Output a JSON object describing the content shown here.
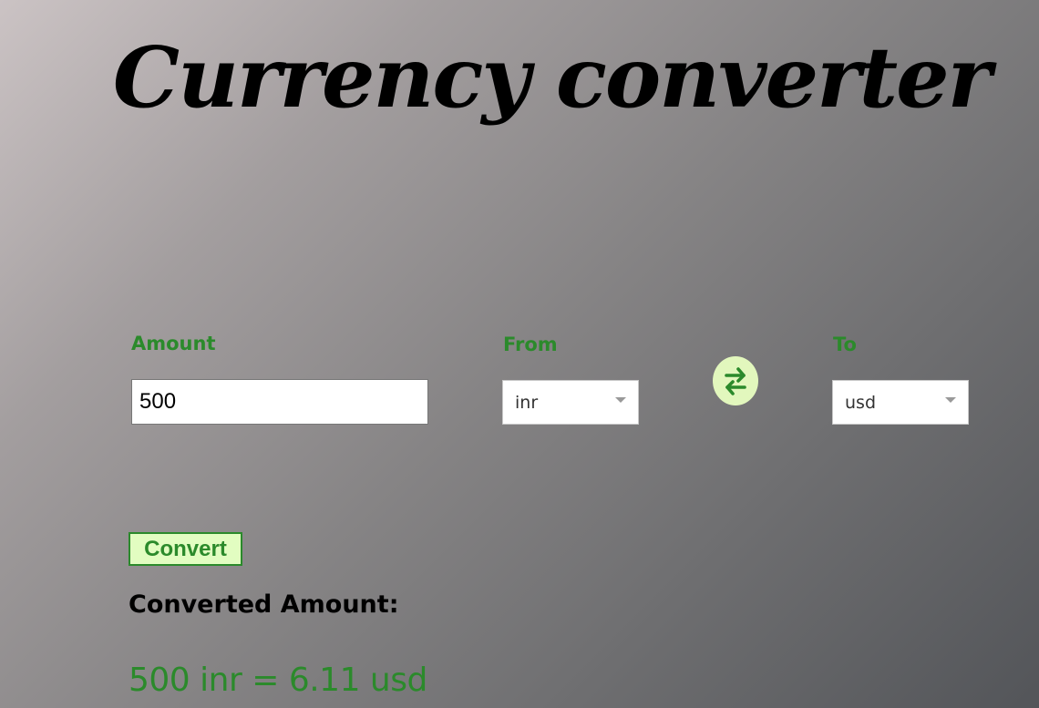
{
  "title": "Currency converter",
  "amount": {
    "label": "Amount",
    "value": "500"
  },
  "from": {
    "label": "From",
    "selected": "inr"
  },
  "to": {
    "label": "To",
    "selected": "usd"
  },
  "swap": {
    "icon": "swap-arrows-icon"
  },
  "convert_button": {
    "label": "Convert"
  },
  "result": {
    "heading": "Converted Amount:",
    "text": "500 inr = 6.11 usd"
  },
  "colors": {
    "accent_green": "#2b8a2b",
    "button_bg": "#e2fdc1",
    "swap_bg": "#e2f7bd"
  }
}
